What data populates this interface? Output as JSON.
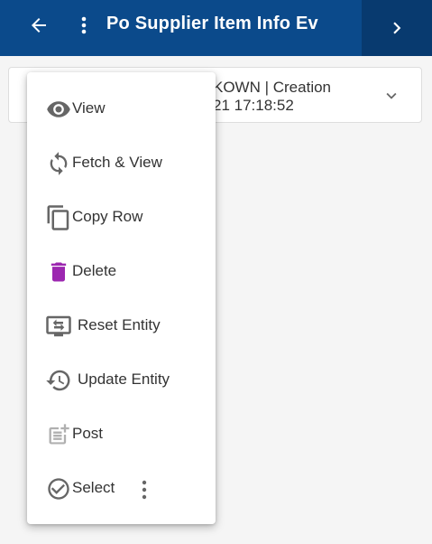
{
  "appbar": {
    "title": "Po Supplier Item Info Ev",
    "back_icon": "arrow-left-icon",
    "menu_icon": "more-vertical-icon",
    "next_icon": "chevron-right-icon",
    "bg_color": "#0b4a8b",
    "next_bg_color": "#083a6f"
  },
  "record_card": {
    "line1": "KOWN | Creation",
    "line2": "21 17:18:52",
    "expand_icon": "chevron-down-icon"
  },
  "context_menu": {
    "items": [
      {
        "label": "View",
        "icon": "eye-icon"
      },
      {
        "label": "Fetch & View",
        "icon": "refresh-icon"
      },
      {
        "label": "Copy Row",
        "icon": "copy-icon"
      },
      {
        "label": "Delete",
        "icon": "trash-icon",
        "icon_color": "#9c27b0"
      },
      {
        "label": "Reset Entity",
        "icon": "reset-screen-icon"
      },
      {
        "label": "Update Entity",
        "icon": "history-icon"
      },
      {
        "label": "Post",
        "icon": "post-add-icon",
        "disabled": true
      },
      {
        "label": "Select",
        "icon": "check-circle-icon",
        "extra_icon": "more-vertical-icon"
      }
    ]
  }
}
